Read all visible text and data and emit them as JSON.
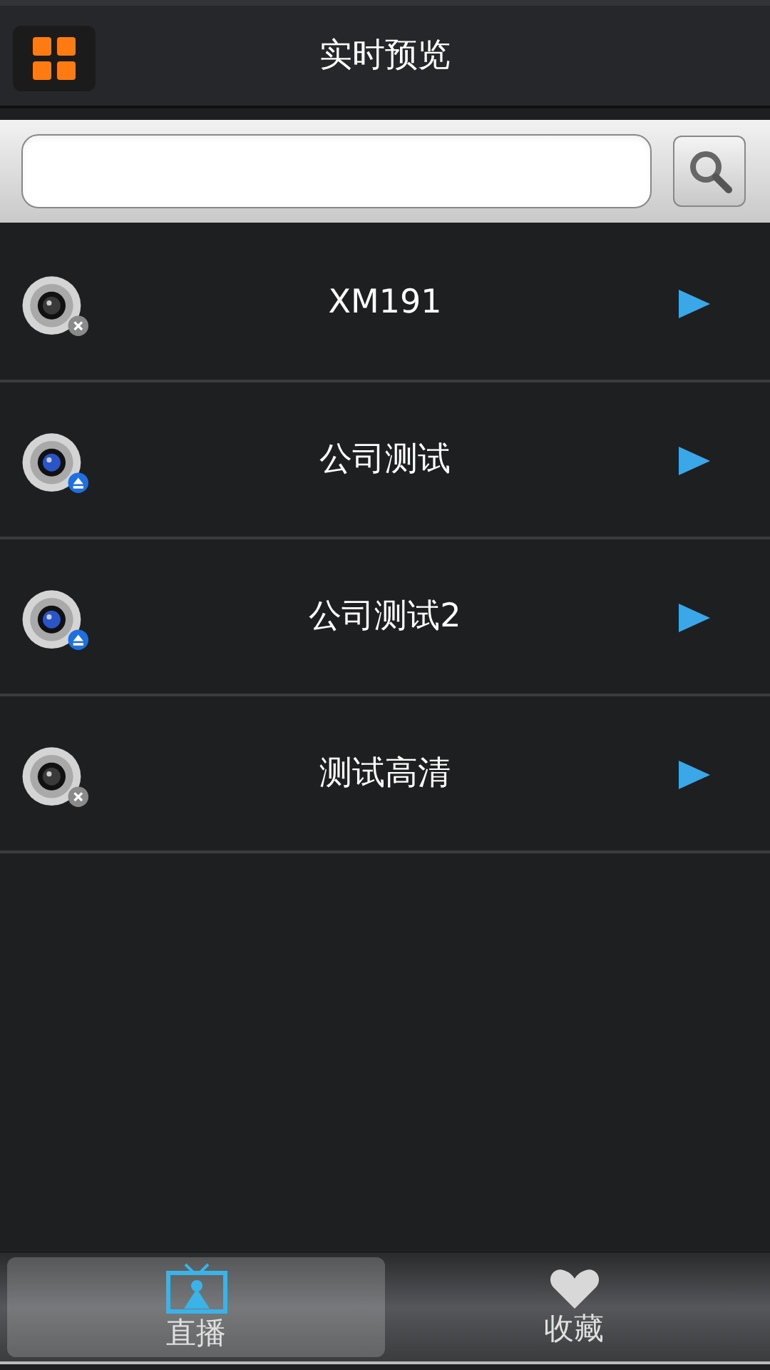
{
  "header": {
    "title": "实时预览"
  },
  "devices": [
    {
      "name": "XM191",
      "online": false
    },
    {
      "name": "公司测试",
      "online": true
    },
    {
      "name": "公司测试2",
      "online": true
    },
    {
      "name": "测试高清",
      "online": false
    }
  ],
  "tabs": [
    {
      "label": "直播",
      "kind": "live",
      "selected": true
    },
    {
      "label": "收藏",
      "kind": "favorites",
      "selected": false
    }
  ]
}
